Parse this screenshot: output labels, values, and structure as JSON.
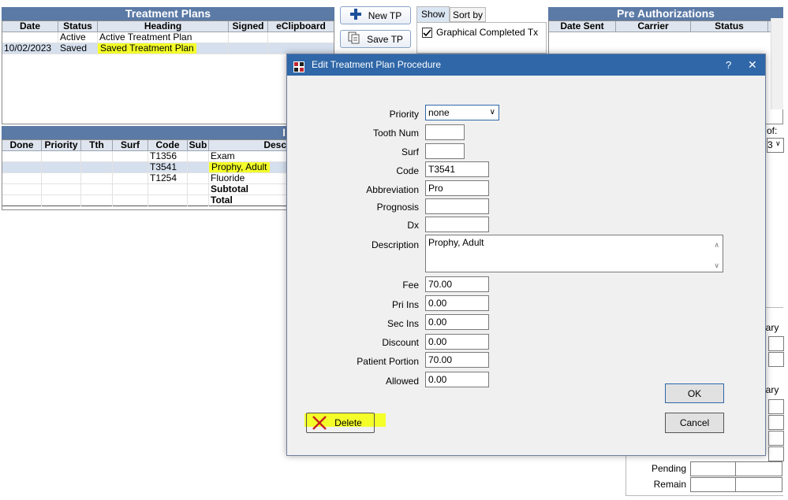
{
  "treatment_plans": {
    "title": "Treatment Plans",
    "columns": [
      "Date",
      "Status",
      "Heading",
      "Signed",
      "eClipboard"
    ],
    "rows": [
      {
        "date": "",
        "status": "Active",
        "heading": "Active Treatment Plan",
        "signed": "",
        "eclipboard": ""
      },
      {
        "date": "10/02/2023",
        "status": "Saved",
        "heading": "Saved Treatment Plan",
        "signed": "",
        "eclipboard": ""
      }
    ]
  },
  "toolbar": {
    "new_tp": "New TP",
    "save_tp": "Save TP"
  },
  "show_tabs": {
    "tabs": [
      "Show",
      "Sort by"
    ],
    "graphical_completed": "Graphical Completed Tx"
  },
  "pre_auth": {
    "title": "Pre Authorizations",
    "columns": [
      "Date Sent",
      "Carrier",
      "Status"
    ]
  },
  "procedures": {
    "title_fragment": "I",
    "columns": [
      "Done",
      "Priority",
      "Tth",
      "Surf",
      "Code",
      "Sub",
      "Desc"
    ],
    "rows": [
      {
        "code": "T1356",
        "desc": "Exam"
      },
      {
        "code": "T3541",
        "desc": "Prophy, Adult"
      },
      {
        "code": "T1254",
        "desc": "Fluoride"
      },
      {
        "code": "",
        "desc": "Subtotal"
      },
      {
        "code": "",
        "desc": "Total"
      }
    ]
  },
  "right_panel": {
    "of_label": "of:",
    "dropdown_value": "3",
    "frag1": "lary",
    "frag2": "lary",
    "pending": "Pending",
    "remain": "Remain"
  },
  "dialog": {
    "title": "Edit Treatment Plan Procedure",
    "help": "?",
    "close": "✕",
    "fields": {
      "priority_label": "Priority",
      "priority_value": "none",
      "tooth_label": "Tooth Num",
      "tooth_value": "",
      "surf_label": "Surf",
      "surf_value": "",
      "code_label": "Code",
      "code_value": "T3541",
      "abbr_label": "Abbreviation",
      "abbr_value": "Pro",
      "prognosis_label": "Prognosis",
      "prognosis_value": "",
      "dx_label": "Dx",
      "dx_value": "",
      "desc_label": "Description",
      "desc_value": "Prophy, Adult",
      "fee_label": "Fee",
      "fee_value": "70.00",
      "pri_label": "Pri Ins",
      "pri_value": "0.00",
      "sec_label": "Sec Ins",
      "sec_value": "0.00",
      "discount_label": "Discount",
      "discount_value": "0.00",
      "patient_label": "Patient Portion",
      "patient_value": "70.00",
      "allowed_label": "Allowed",
      "allowed_value": "0.00"
    },
    "ok": "OK",
    "cancel": "Cancel",
    "delete": "Delete"
  },
  "colors": {
    "title_bar": "#2f67a8",
    "grid_title": "#5b7aa6",
    "highlight": "#f4ff2a"
  }
}
